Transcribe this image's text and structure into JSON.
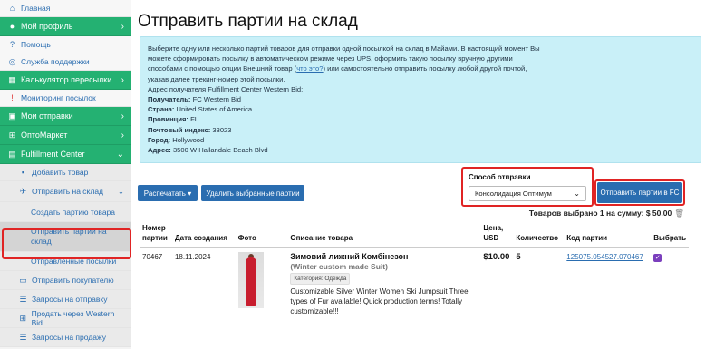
{
  "sidebar": {
    "home": "Главная",
    "profile": "Мой профиль",
    "help": "Помощь",
    "support": "Служба поддержки",
    "calc": "Калькулятор пересылки",
    "monitor": "Мониторинг посылок",
    "shipments": "Мои отправки",
    "optomarket": "ОптоМаркет",
    "fulfillment": "Fulfillment Center",
    "add_product": "Добавить товар",
    "send_to_warehouse": "Отправить на склад",
    "create_batch": "Создать партию товара",
    "send_batches": "Отправить партии на склад",
    "sent_parcels": "Отправленные посылки",
    "send_to_buyer": "Отправить покупателю",
    "shipping_requests": "Запросы на отправку",
    "sell_via_wb": "Продать через Western Bid",
    "sale_requests": "Запросы на продажу"
  },
  "page": {
    "title": "Отправить партии на склад"
  },
  "info": {
    "line1": "Выберите одну или несколько партий товаров для отправки одной посылкой на склад в Майами. В настоящий момент Вы",
    "line2": "можете сформировать посылку в автоматическом режиме через UPS, оформить такую посылку вручную другими",
    "line3a": "способами с помощью опции Внешний товар (",
    "line3link": "что это?",
    "line3b": ") или самостоятельно отправить посылку любой другой почтой,",
    "line4": "указав далее трекинг-номер этой посылки.",
    "address_intro": "Адрес получателя Fulfillment Center Western Bid:",
    "recipient_label": "Получатель:",
    "recipient": "FC Western Bid",
    "country_label": "Страна:",
    "country": "United States of America",
    "province_label": "Провинция:",
    "province": "FL",
    "zip_label": "Почтовый индекс:",
    "zip": "33023",
    "city_label": "Город:",
    "city": "Hollywood",
    "address_label": "Адрес:",
    "address": "3500 W Hallandale Beach Blvd"
  },
  "toolbar": {
    "print": "Распечатать",
    "delete": "Удалить выбранные партии",
    "ship_method_label": "Способ отправки",
    "ship_method": "Консолидация Оптимум",
    "send": "Отправить партии в FC"
  },
  "total": "Товаров выбрано 1 на сумму: $ 50.00",
  "table": {
    "headers": {
      "batch_no": "Номер партии",
      "created": "Дата создания",
      "photo": "Фото",
      "desc": "Описание товара",
      "price": "Цена, USD",
      "qty": "Количество",
      "code": "Код партии",
      "select": "Выбрать"
    },
    "row": {
      "batch_no": "70467",
      "created": "18.11.2024",
      "title": "Зимовий лижний Комбінезон",
      "subtitle": "(Winter custom made Suit)",
      "category": "Категория: Одежда",
      "description": "Customizable Silver Winter Women Ski Jumpsuit Three types of Fur available! Quick production terms! Totally customizable!!!",
      "price": "$10.00",
      "qty": "5",
      "code": "125075.054527.070467"
    }
  },
  "colors": {
    "green": "#24b172",
    "blue": "#2a6db0",
    "info_bg": "#c9f0f8",
    "highlight": "#e02424"
  }
}
